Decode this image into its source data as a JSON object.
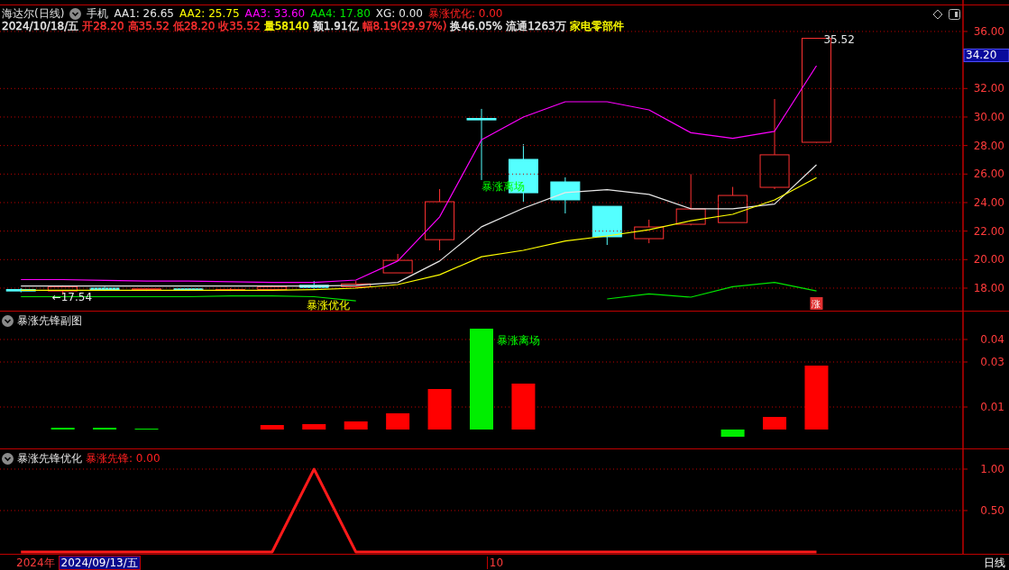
{
  "main_panel": {
    "title": "海达尔(日线)",
    "indicator_name": "手机",
    "legend": [
      {
        "label": "AA1: 26.65",
        "color": "#e8e8e8"
      },
      {
        "label": "AA2: 25.75",
        "color": "#ffff00"
      },
      {
        "label": "AA3: 33.60",
        "color": "#ff00ff"
      },
      {
        "label": "AA4: 17.80",
        "color": "#00e600"
      },
      {
        "label": "XG: 0.00",
        "color": "#e8e8e8"
      },
      {
        "label": "暴涨优化: 0.00",
        "color": "#ff2020"
      }
    ],
    "quote": [
      {
        "text": "2024/10/18/五",
        "color": "#e8e8e8"
      },
      {
        "text": "开28.20",
        "color": "#ff3030"
      },
      {
        "text": "高35.52",
        "color": "#ff3030"
      },
      {
        "text": "低28.20",
        "color": "#ff3030"
      },
      {
        "text": "收35.52",
        "color": "#ff3030"
      },
      {
        "text": "量58140",
        "color": "#ffff00"
      },
      {
        "text": "额1.91亿",
        "color": "#e8e8e8"
      },
      {
        "text": "幅8.19(29.97%)",
        "color": "#ff3030"
      },
      {
        "text": "换46.05%",
        "color": "#e8e8e8"
      },
      {
        "text": "流通1263万",
        "color": "#e8e8e8"
      },
      {
        "text": "家电零部件",
        "color": "#ffff00"
      }
    ],
    "price_marker": "34.20",
    "badge": "涨",
    "chart_data": {
      "type": "line",
      "grid": true,
      "ylim": [
        16.42,
        37.86
      ],
      "yticks": [
        {
          "value": 18,
          "label": "18.00"
        },
        {
          "value": 20,
          "label": "20.00"
        },
        {
          "value": 22,
          "label": "22.00"
        },
        {
          "value": 24,
          "label": "24.00"
        },
        {
          "value": 26,
          "label": "26.00"
        },
        {
          "value": 28,
          "label": "28.00"
        },
        {
          "value": 30,
          "label": "30.00"
        },
        {
          "value": 32,
          "label": "32.00"
        },
        {
          "value": 36,
          "label": "36.00"
        }
      ],
      "series": [
        {
          "color": "#ff00ff",
          "values": [
            18.6,
            18.6,
            18.55,
            18.5,
            18.5,
            18.45,
            18.4,
            18.4,
            18.57,
            19.9,
            23.0,
            28.4,
            30.0,
            31.07,
            31.07,
            30.5,
            28.9,
            28.5,
            29.0,
            33.6,
            null,
            null,
            null
          ]
        },
        {
          "color": "#e8e8e8",
          "values": [
            18.15,
            18.15,
            18.15,
            18.15,
            18.15,
            18.15,
            18.15,
            18.15,
            18.2,
            18.4,
            19.9,
            22.3,
            23.6,
            24.7,
            24.9,
            24.57,
            23.56,
            23.56,
            23.9,
            26.65,
            null,
            null,
            null
          ]
        },
        {
          "color": "#ffff00",
          "values": [
            17.85,
            17.85,
            17.85,
            17.85,
            17.85,
            17.85,
            17.85,
            17.9,
            18.0,
            18.25,
            18.94,
            20.2,
            20.65,
            21.3,
            21.66,
            22.1,
            22.73,
            23.18,
            24.19,
            25.75,
            null,
            null,
            null
          ]
        },
        {
          "color": "#00e600",
          "values": [
            17.4,
            17.4,
            17.4,
            17.4,
            17.4,
            17.45,
            17.45,
            17.4,
            17.1,
            null,
            null,
            null,
            null,
            null,
            17.24,
            17.6,
            17.37,
            18.1,
            18.4,
            17.8,
            null,
            null,
            null
          ]
        }
      ],
      "annotations": [
        "暴涨优化",
        "暴涨离场",
        "←17.54",
        "35.52"
      ]
    }
  },
  "sub_panel": {
    "title": "暴涨先锋副图",
    "chart_data": {
      "type": "bar",
      "grid": true,
      "ylim": [
        -0.0088,
        0.0524
      ],
      "yticks": [
        0.04,
        0.03,
        0.01
      ],
      "series": [
        {
          "color": "#ff0000",
          "values": [
            null,
            null,
            null,
            null,
            null,
            null,
            0.002,
            0.0024,
            0.0036,
            0.0072,
            0.018,
            null,
            0.0204,
            null,
            null,
            null,
            null,
            null,
            0.0056,
            0.0284,
            null,
            null,
            null
          ]
        },
        {
          "color": "#00ee00",
          "values": [
            null,
            0.0008,
            0.0008,
            0.0004,
            null,
            null,
            null,
            null,
            null,
            null,
            null,
            0.0448,
            null,
            null,
            null,
            null,
            null,
            -0.0032,
            null,
            null,
            null,
            null,
            null
          ]
        }
      ],
      "annotations": [
        "暴涨离场"
      ]
    }
  },
  "signal_panel": {
    "title": "暴涨先锋优化",
    "legend": [
      {
        "label": "暴涨先锋: 0.00",
        "color": "#ff2020"
      }
    ],
    "chart_data": {
      "type": "line",
      "grid": true,
      "ylim": [
        -0.033,
        1.239
      ],
      "yticks": [
        {
          "value": 1,
          "label": "1.00"
        },
        {
          "value": 0.5,
          "label": "0.50"
        }
      ],
      "series": [
        {
          "color": "#ff1a1a",
          "values": [
            0,
            0,
            0,
            0,
            0,
            0,
            0,
            1,
            0,
            0,
            0,
            0,
            0,
            0,
            0,
            0,
            0,
            0,
            0,
            0,
            null,
            null,
            null
          ]
        }
      ]
    }
  },
  "time_axis": {
    "year": "2024年",
    "cursor_date": "2024/09/13/五",
    "month": "10",
    "period": "日线"
  }
}
